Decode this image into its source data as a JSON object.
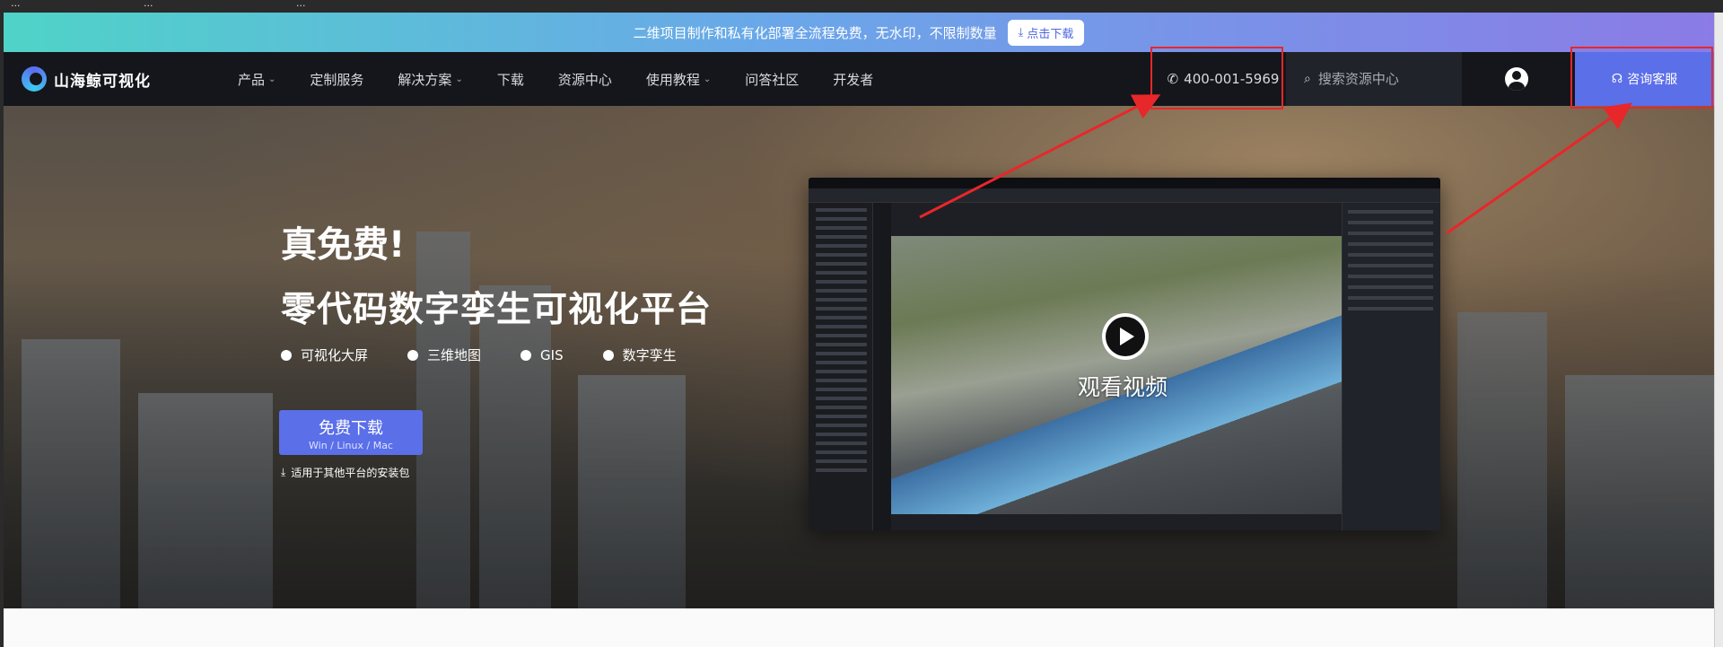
{
  "browser_tabs": [
    "...",
    "...",
    "..."
  ],
  "banner": {
    "text": "二维项目制作和私有化部署全流程免费，无水印，不限制数量",
    "button": "点击下载"
  },
  "nav": {
    "logo": "山海鲸可视化",
    "items": [
      {
        "label": "产品",
        "dropdown": true
      },
      {
        "label": "定制服务",
        "dropdown": false
      },
      {
        "label": "解决方案",
        "dropdown": true
      },
      {
        "label": "下载",
        "dropdown": false
      },
      {
        "label": "资源中心",
        "dropdown": false
      },
      {
        "label": "使用教程",
        "dropdown": true
      },
      {
        "label": "问答社区",
        "dropdown": false
      },
      {
        "label": "开发者",
        "dropdown": false
      }
    ],
    "phone": "400-001-5969",
    "search_placeholder": "搜索资源中心",
    "consult": "咨询客服"
  },
  "hero": {
    "title": "真免费!",
    "subtitle": "零代码数字孪生可视化平台",
    "tags": [
      "可视化大屏",
      "三维地图",
      "GIS",
      "数字孪生"
    ],
    "download_main": "免费下载",
    "download_sub": "Win / Linux / Mac",
    "other_platforms": "适用于其他平台的安装包",
    "watch_video": "观看视频"
  },
  "colors": {
    "accent": "#5b6fe9",
    "nav_bg": "#14161b",
    "annotation": "#e8272a"
  }
}
